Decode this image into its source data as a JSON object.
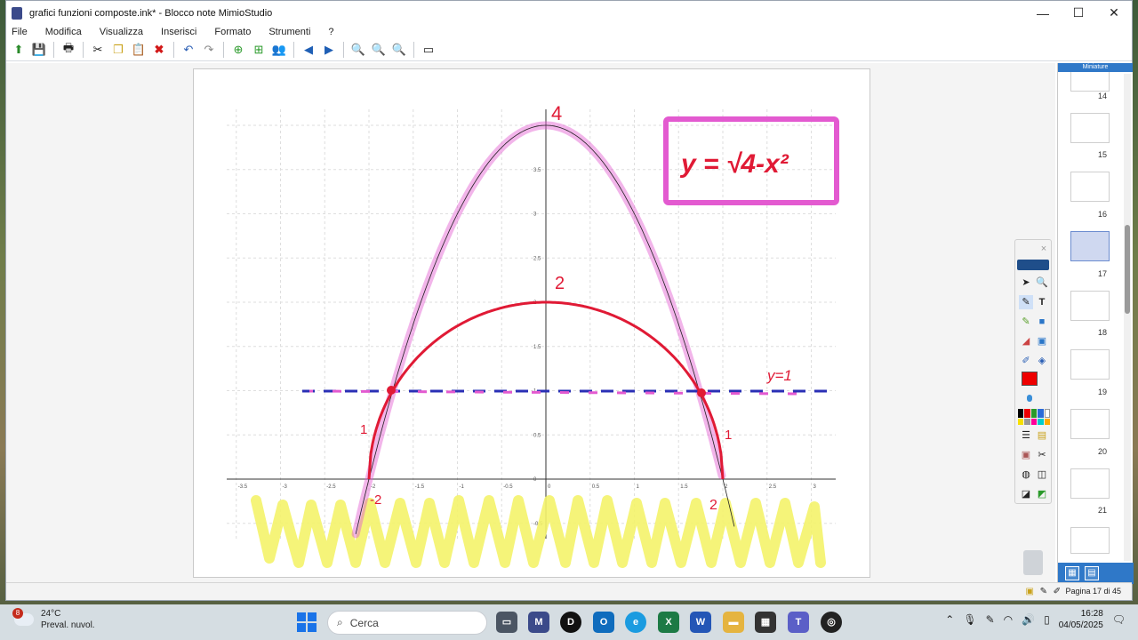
{
  "window": {
    "title": "grafici funzioni composte.ink* - Blocco note MimioStudio",
    "minimize": "—",
    "maximize": "☐",
    "close": "✕"
  },
  "menu": [
    "File",
    "Modifica",
    "Visualizza",
    "Inserisci",
    "Formato",
    "Strumenti",
    "?"
  ],
  "toolbar": {
    "icons": [
      "open-icon",
      "save-icon",
      "print-icon",
      "cut-icon",
      "copy-icon",
      "paste-icon",
      "delete-icon",
      "undo-icon",
      "redo-icon",
      "new-page-icon",
      "insert-page-icon",
      "users-icon",
      "back-icon",
      "forward-icon",
      "zoom-in-icon",
      "zoom-out-icon",
      "zoom-fit-icon",
      "screen-icon"
    ]
  },
  "graph": {
    "x_ticks": [
      "-3.5",
      "-3",
      "-2.5",
      "-2",
      "-1.5",
      "-1",
      "-0.5",
      "0",
      "0.5",
      "1",
      "1.5",
      "2",
      "2.5",
      "3"
    ],
    "y_ticks": [
      "4",
      "3.5",
      "3",
      "2.5",
      "2",
      "1.5",
      "1",
      "0.5",
      "0",
      "-0.5"
    ]
  },
  "annotations": {
    "equation": "y = √4-x²",
    "label_4": "4",
    "label_2": "2",
    "label_y1": "y=1",
    "label_neg2": "-2",
    "label_pos2": "2",
    "label_1a": "1",
    "label_1b": "1",
    "colors": {
      "pink": "#e35ad0",
      "red": "#e01a35",
      "blue": "#2a2fb5",
      "yellow": "#f4f36a"
    }
  },
  "thumbnails": {
    "header": "Miniature",
    "pages": [
      "14",
      "15",
      "16",
      "17",
      "18",
      "19",
      "20",
      "21"
    ],
    "selected": "17"
  },
  "status": {
    "page": "Pagina 17 di 45"
  },
  "taskbar": {
    "weather_temp": "24°C",
    "weather_desc": "Preval. nuvol.",
    "weather_badge": "8",
    "search_placeholder": "Cerca",
    "time": "16:28",
    "date": "04/05/2025"
  }
}
